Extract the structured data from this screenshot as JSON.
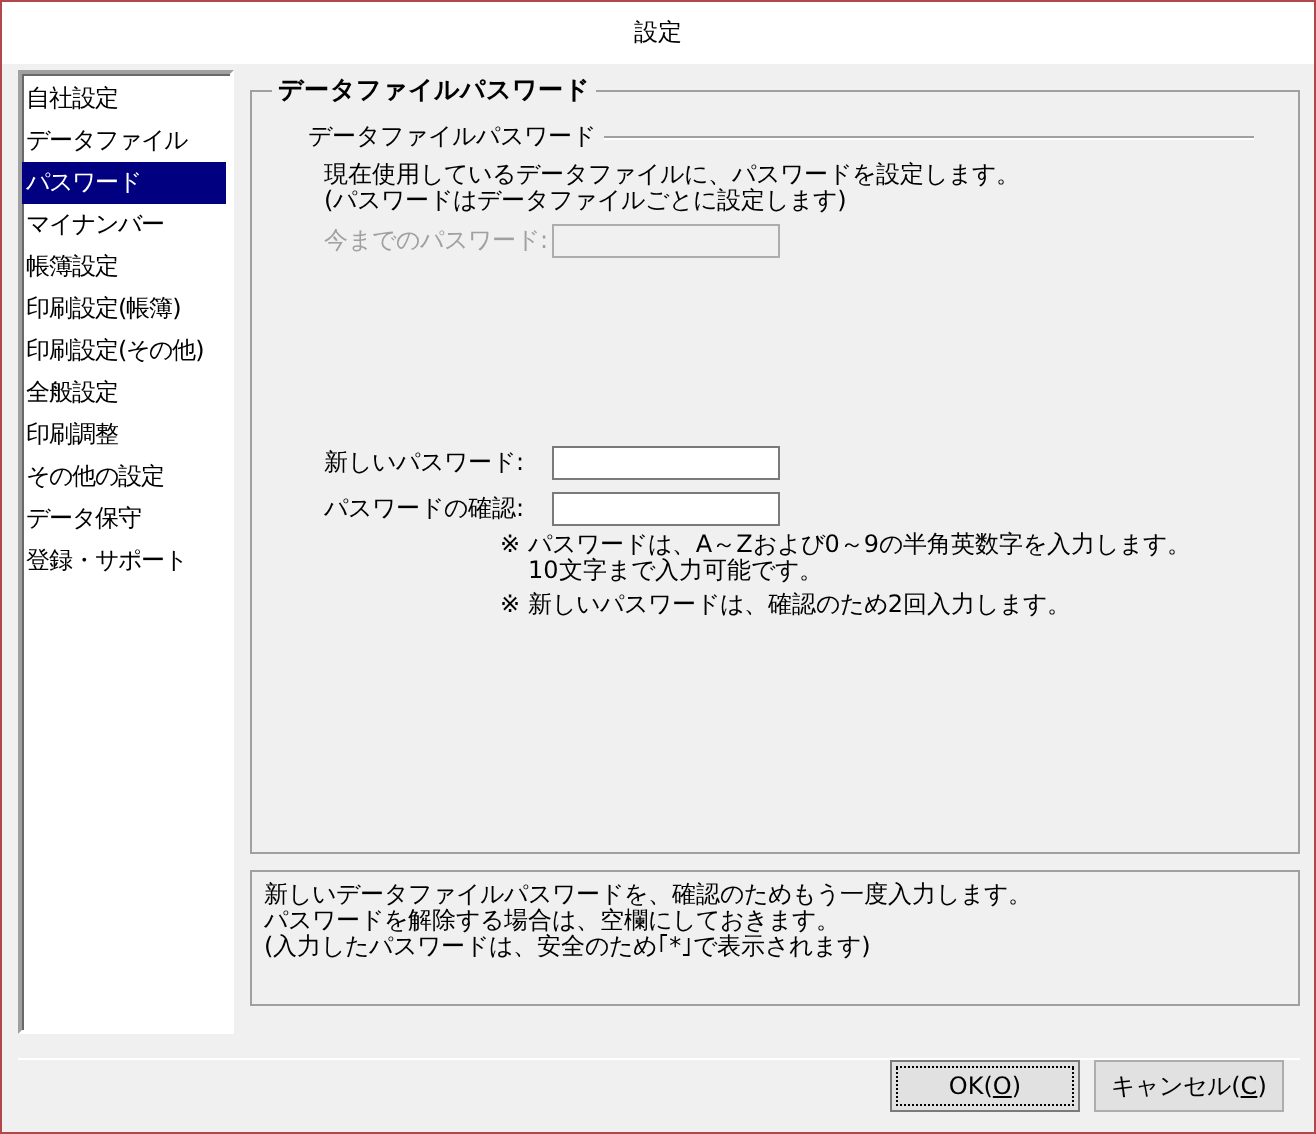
{
  "window": {
    "title": "設定"
  },
  "sidebar": {
    "items": [
      {
        "label": "自社設定",
        "selected": false
      },
      {
        "label": "データファイル",
        "selected": false
      },
      {
        "label": "パスワード",
        "selected": true
      },
      {
        "label": "マイナンバー",
        "selected": false
      },
      {
        "label": "帳簿設定",
        "selected": false
      },
      {
        "label": "印刷設定(帳簿)",
        "selected": false
      },
      {
        "label": "印刷設定(その他)",
        "selected": false
      },
      {
        "label": "全般設定",
        "selected": false
      },
      {
        "label": "印刷調整",
        "selected": false
      },
      {
        "label": "その他の設定",
        "selected": false
      },
      {
        "label": "データ保守",
        "selected": false
      },
      {
        "label": "登録・サポート",
        "selected": false
      }
    ]
  },
  "panel": {
    "title": "データファイルパスワード",
    "section": "データファイルパスワード",
    "description": [
      "現在使用しているデータファイルに、パスワードを設定します。",
      "(パスワードはデータファイルごとに設定します)"
    ],
    "field_groups": [
      [
        {
          "label": "今までのパスワード:",
          "disabled": true
        }
      ],
      [
        {
          "label": "新しいパスワード:",
          "disabled": false
        },
        {
          "label": "パスワードの確認:",
          "disabled": false
        }
      ]
    ],
    "notes": [
      [
        "※ パスワードは、A～Zおよび0～9の半角英数字を入力します。",
        "10文字まで入力可能です。"
      ],
      [
        "※ 新しいパスワードは、確認のため2回入力します。"
      ]
    ]
  },
  "help": [
    "新しいデータファイルパスワードを、確認のためもう一度入力します。",
    "パスワードを解除する場合は、空欄にしておきます。",
    "(入力したパスワードは、安全のため｢*｣で表示されます)"
  ],
  "buttons": [
    {
      "before": "OK(",
      "access_key": "O",
      "after": ")",
      "default": true
    },
    {
      "before": "キャンセル(",
      "access_key": "C",
      "after": ")",
      "default": false
    }
  ]
}
